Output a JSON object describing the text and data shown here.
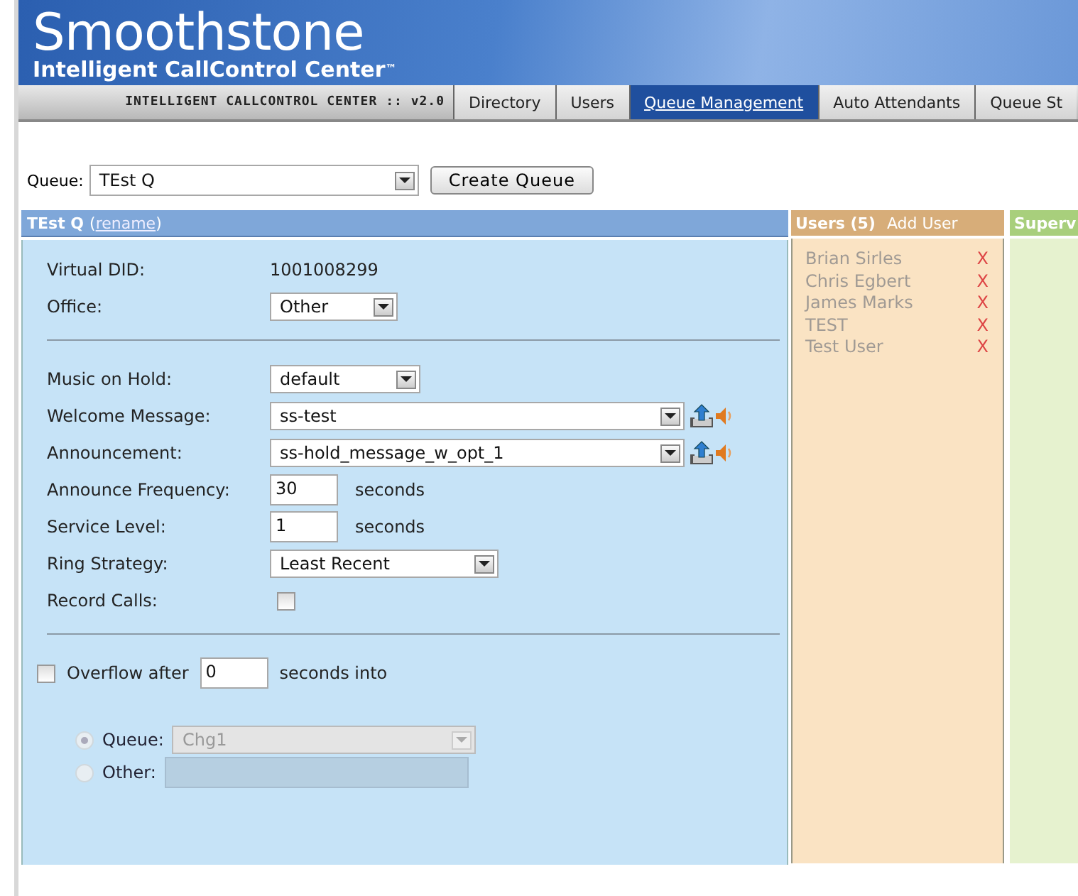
{
  "header": {
    "brand": "Smoothstone",
    "subtitle": "Intelligent CallControl Center",
    "trademark": "™"
  },
  "nav": {
    "version_label": "INTELLIGENT CALLCONTROL CENTER :: v2.0",
    "tabs": [
      {
        "label": "Directory",
        "selected": false
      },
      {
        "label": "Users",
        "selected": false
      },
      {
        "label": "Queue Management",
        "selected": true
      },
      {
        "label": "Auto Attendants",
        "selected": false
      },
      {
        "label": "Queue St",
        "selected": false
      }
    ]
  },
  "queue_picker": {
    "label": "Queue:",
    "value": "TEst Q",
    "button": "Create Queue"
  },
  "queue_panel": {
    "title": "TEst Q",
    "rename_open": "(",
    "rename_link": "rename",
    "rename_close": ")",
    "groups": [
      [
        {
          "kind": "text",
          "label": "Virtual DID:",
          "value": "1001008299"
        },
        {
          "kind": "select",
          "label": "Office:",
          "value": "Other"
        }
      ],
      [
        {
          "kind": "select",
          "label": "Music on Hold:",
          "value": "default"
        },
        {
          "kind": "audio",
          "label": "Welcome Message:",
          "value": "ss-test"
        },
        {
          "kind": "audio",
          "label": "Announcement:",
          "value": "ss-hold_message_w_opt_1"
        },
        {
          "kind": "number",
          "label": "Announce Frequency:",
          "value": "30",
          "unit": "seconds"
        },
        {
          "kind": "number",
          "label": "Service Level:",
          "value": "1",
          "unit": "seconds"
        },
        {
          "kind": "select",
          "label": "Ring Strategy:",
          "value": "Least Recent"
        },
        {
          "kind": "checkbox",
          "label": "Record Calls:",
          "checked": false
        }
      ]
    ],
    "overflow": {
      "checked": false,
      "label": "Overflow after",
      "value": "0",
      "unit": "seconds into",
      "disabled": true,
      "targets": [
        {
          "kind": "select",
          "label": "Queue:",
          "value": "Chg1",
          "selected": true
        },
        {
          "kind": "text",
          "label": "Other:",
          "selected": false
        }
      ]
    }
  },
  "users_panel": {
    "title": "Users (5)",
    "add_link": "Add User",
    "users": [
      {
        "name": "Brian Sirles",
        "remove": "X"
      },
      {
        "name": "Chris Egbert",
        "remove": "X"
      },
      {
        "name": "James Marks",
        "remove": "X"
      },
      {
        "name": "TEST",
        "remove": "X"
      },
      {
        "name": "Test User",
        "remove": "X"
      }
    ]
  },
  "supervisors_panel": {
    "title": "Superv"
  }
}
